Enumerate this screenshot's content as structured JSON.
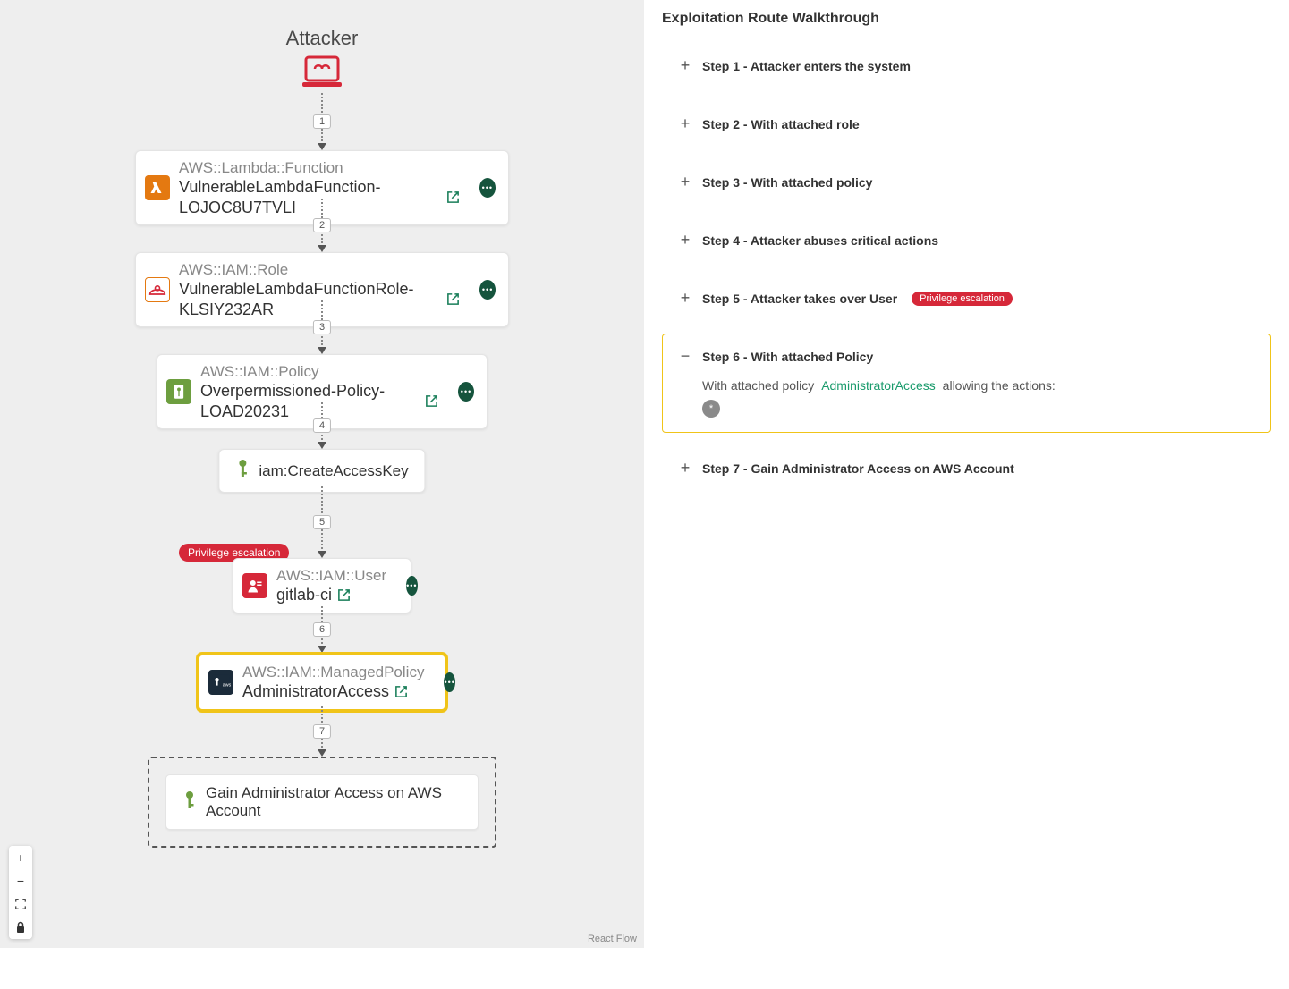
{
  "canvas": {
    "attribution": "React Flow",
    "attacker_label": "Attacker",
    "edges": [
      "1",
      "2",
      "3",
      "4",
      "5",
      "6",
      "7"
    ],
    "priv_badge": "Privilege escalation",
    "nodes": {
      "n1": {
        "type": "AWS::Lambda::Function",
        "name": "VulnerableLambdaFunction-LOJOC8U7TVLI"
      },
      "n2": {
        "type": "AWS::IAM::Role",
        "name": "VulnerableLambdaFunctionRole-KLSIY232AR"
      },
      "n3": {
        "type": "AWS::IAM::Policy",
        "name": "Overpermissioned-Policy-LOAD20231"
      },
      "n4": {
        "name": "iam:CreateAccessKey"
      },
      "n5": {
        "type": "AWS::IAM::User",
        "name": "gitlab-ci"
      },
      "n6": {
        "type": "AWS::IAM::ManagedPolicy",
        "name": "AdministratorAccess"
      },
      "goal": {
        "name": "Gain Administrator Access on AWS Account"
      }
    }
  },
  "side": {
    "title": "Exploitation Route Walkthrough",
    "steps": [
      {
        "title": "Step 1 - Attacker enters the system"
      },
      {
        "title": "Step 2 - With attached role"
      },
      {
        "title": "Step 3 - With attached policy"
      },
      {
        "title": "Step 4 - Attacker abuses critical actions"
      },
      {
        "title": "Step 5 - Attacker takes over User",
        "badge": "Privilege escalation"
      },
      {
        "title": "Step 6 - With attached Policy",
        "body_prefix": "With attached policy",
        "body_policy": "AdministratorAccess",
        "body_suffix": "allowing the actions:",
        "action_glyph": "*"
      },
      {
        "title": "Step 7 - Gain Administrator Access on AWS Account"
      }
    ]
  }
}
